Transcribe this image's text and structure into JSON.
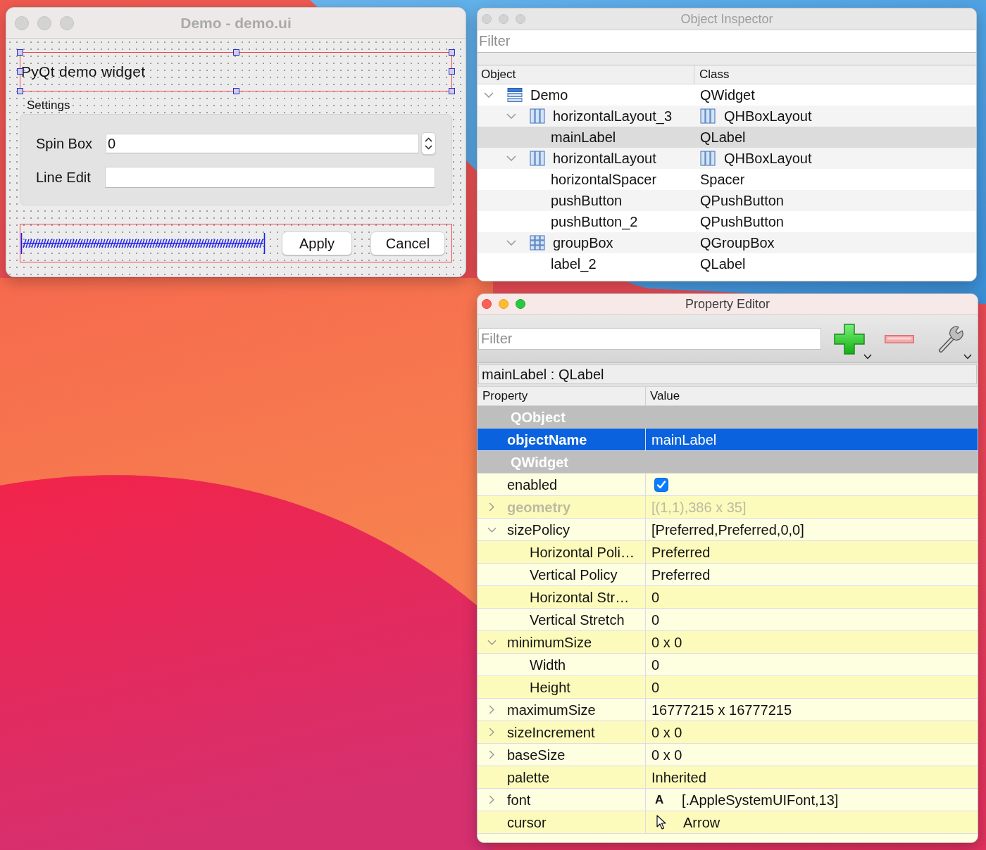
{
  "demo_window": {
    "title": "Demo - demo.ui",
    "active": false,
    "main_label": {
      "text": "PyQt demo widget",
      "selected": true
    },
    "group_box": {
      "title": "Settings",
      "fields": [
        {
          "kind": "spin",
          "label": "Spin Box",
          "value": "0"
        },
        {
          "kind": "line",
          "label": "Line Edit"
        }
      ]
    },
    "buttons": [
      "Apply",
      "Cancel"
    ]
  },
  "object_inspector": {
    "title": "Object Inspector",
    "active": false,
    "filter": {
      "placeholder": "Filter"
    },
    "columns": [
      "Object",
      "Class"
    ],
    "tree": [
      {
        "name": "Demo",
        "class": "QWidget",
        "kind": "form",
        "selected": false,
        "expanded": true,
        "children": [
          {
            "name": "horizontalLayout_3",
            "class": "QHBoxLayout",
            "kind": "hbox",
            "selected": false,
            "expanded": true,
            "children": [
              {
                "name": "mainLabel",
                "class": "QLabel",
                "kind": "plain",
                "selected": true
              }
            ]
          },
          {
            "name": "horizontalLayout",
            "class": "QHBoxLayout",
            "kind": "hbox",
            "selected": false,
            "expanded": true,
            "children": [
              {
                "name": "horizontalSpacer",
                "class": "Spacer",
                "kind": "plain",
                "selected": false
              },
              {
                "name": "pushButton",
                "class": "QPushButton",
                "kind": "plain",
                "selected": false
              },
              {
                "name": "pushButton_2",
                "class": "QPushButton",
                "kind": "plain",
                "selected": false
              }
            ]
          },
          {
            "name": "groupBox",
            "class": "QGroupBox",
            "kind": "grid",
            "selected": false,
            "expanded": true,
            "children": [
              {
                "name": "label_2",
                "class": "QLabel",
                "kind": "plain",
                "selected": false
              }
            ]
          }
        ]
      }
    ]
  },
  "property_editor": {
    "title": "Property Editor",
    "active": true,
    "filter": {
      "placeholder": "Filter"
    },
    "object_label": "mainLabel : QLabel",
    "columns": [
      "Property",
      "Value"
    ],
    "groups": [
      {
        "name": "QObject",
        "rows": [
          {
            "name": "objectName",
            "kind": "text",
            "value": "mainLabel",
            "selected": true,
            "modified": true,
            "disabled": false
          }
        ]
      },
      {
        "name": "QWidget",
        "rows": [
          {
            "name": "enabled",
            "kind": "checkbox",
            "checked": true,
            "selected": false,
            "modified": false,
            "disabled": false
          },
          {
            "name": "geometry",
            "kind": "text",
            "value": "[(1,1),386 x 35]",
            "selected": false,
            "modified": true,
            "disabled": true,
            "expanded": false
          },
          {
            "name": "sizePolicy",
            "kind": "text",
            "value": "[Preferred,Preferred,0,0]",
            "selected": false,
            "modified": false,
            "disabled": false,
            "expanded": true,
            "children": [
              {
                "name": "Horizontal Poli…",
                "kind": "text",
                "value": "Preferred",
                "selected": false,
                "modified": false,
                "disabled": false
              },
              {
                "name": "Vertical Policy",
                "kind": "text",
                "value": "Preferred",
                "selected": false,
                "modified": false,
                "disabled": false
              },
              {
                "name": "Horizontal Str…",
                "kind": "text",
                "value": "0",
                "selected": false,
                "modified": false,
                "disabled": false
              },
              {
                "name": "Vertical Stretch",
                "kind": "text",
                "value": "0",
                "selected": false,
                "modified": false,
                "disabled": false
              }
            ]
          },
          {
            "name": "minimumSize",
            "kind": "text",
            "value": "0 x 0",
            "selected": false,
            "modified": false,
            "disabled": false,
            "expanded": true,
            "children": [
              {
                "name": "Width",
                "kind": "text",
                "value": "0",
                "selected": false,
                "modified": false,
                "disabled": false
              },
              {
                "name": "Height",
                "kind": "text",
                "value": "0",
                "selected": false,
                "modified": false,
                "disabled": false
              }
            ]
          },
          {
            "name": "maximumSize",
            "kind": "text",
            "value": "16777215 x 16777215",
            "selected": false,
            "modified": false,
            "disabled": false,
            "expanded": false
          },
          {
            "name": "sizeIncrement",
            "kind": "text",
            "value": "0 x 0",
            "selected": false,
            "modified": false,
            "disabled": false,
            "expanded": false
          },
          {
            "name": "baseSize",
            "kind": "text",
            "value": "0 x 0",
            "selected": false,
            "modified": false,
            "disabled": false,
            "expanded": false
          },
          {
            "name": "palette",
            "kind": "text",
            "value": "Inherited",
            "selected": false,
            "modified": false,
            "disabled": false
          },
          {
            "name": "font",
            "kind": "font",
            "preview": "A",
            "value": "[.AppleSystemUIFont,13]",
            "selected": false,
            "modified": false,
            "disabled": false,
            "expanded": false
          },
          {
            "name": "cursor",
            "kind": "cursor",
            "value": "Arrow",
            "selected": false,
            "modified": false,
            "disabled": false
          }
        ]
      }
    ]
  }
}
